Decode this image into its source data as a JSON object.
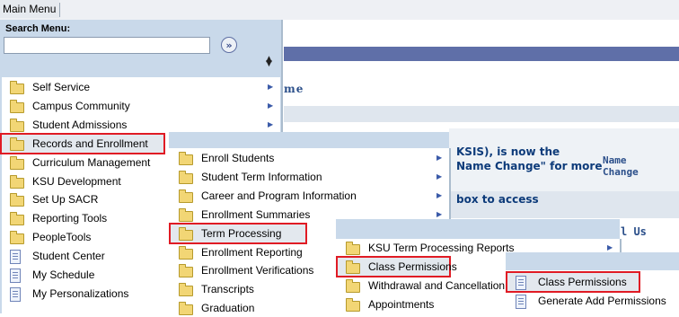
{
  "topbar": {
    "main_menu": "Main Menu"
  },
  "search": {
    "label": "Search Menu:",
    "value": "",
    "go_icon": "double-chevron-right-icon"
  },
  "background": {
    "title_fragment": "me",
    "line1": "KSIS), is now the",
    "line2": "Name Change\" for more",
    "line3": "box to access",
    "col_header": [
      "Name",
      "Change"
    ],
    "link_fragment": "l Us"
  },
  "menu_level1": [
    {
      "label": "Self Service",
      "icon": "folder",
      "arrow": true
    },
    {
      "label": "Campus Community",
      "icon": "folder",
      "arrow": true
    },
    {
      "label": "Student Admissions",
      "icon": "folder",
      "arrow": true
    },
    {
      "label": "Records and Enrollment",
      "icon": "folder",
      "arrow": true,
      "highlighted": true
    },
    {
      "label": "Curriculum Management",
      "icon": "folder",
      "arrow": false
    },
    {
      "label": "KSU Development",
      "icon": "folder",
      "arrow": false
    },
    {
      "label": "Set Up SACR",
      "icon": "folder",
      "arrow": false
    },
    {
      "label": "Reporting Tools",
      "icon": "folder",
      "arrow": false
    },
    {
      "label": "PeopleTools",
      "icon": "folder",
      "arrow": false
    },
    {
      "label": "Student Center",
      "icon": "document",
      "arrow": false
    },
    {
      "label": "My Schedule",
      "icon": "document",
      "arrow": false
    },
    {
      "label": "My Personalizations",
      "icon": "document",
      "arrow": false
    }
  ],
  "menu_level2": [
    {
      "label": "Enroll Students",
      "icon": "folder",
      "arrow": true
    },
    {
      "label": "Student Term Information",
      "icon": "folder",
      "arrow": true
    },
    {
      "label": "Career and Program Information",
      "icon": "folder",
      "arrow": true
    },
    {
      "label": "Enrollment Summaries",
      "icon": "folder",
      "arrow": true
    },
    {
      "label": "Term Processing",
      "icon": "folder",
      "arrow": false,
      "highlighted": true
    },
    {
      "label": "Enrollment Reporting",
      "icon": "folder",
      "arrow": false
    },
    {
      "label": "Enrollment Verifications",
      "icon": "folder",
      "arrow": false
    },
    {
      "label": "Transcripts",
      "icon": "folder",
      "arrow": false
    },
    {
      "label": "Graduation",
      "icon": "folder",
      "arrow": false
    }
  ],
  "menu_level3": [
    {
      "label": "KSU Term Processing Reports",
      "icon": "folder",
      "arrow": true
    },
    {
      "label": "Class Permissions",
      "icon": "folder",
      "arrow": false,
      "highlighted": true
    },
    {
      "label": "Withdrawal and Cancellation",
      "icon": "folder",
      "arrow": false
    },
    {
      "label": "Appointments",
      "icon": "folder",
      "arrow": false
    }
  ],
  "menu_level4": [
    {
      "label": "Class Permissions",
      "icon": "document",
      "highlighted": true
    },
    {
      "label": "Generate Add Permissions",
      "icon": "document"
    }
  ],
  "colors": {
    "menu_panel": "#c9d9ea",
    "highlight_outline": "#e01b24",
    "header_bar": "#5f6fa8",
    "folder": "#f2d675"
  }
}
